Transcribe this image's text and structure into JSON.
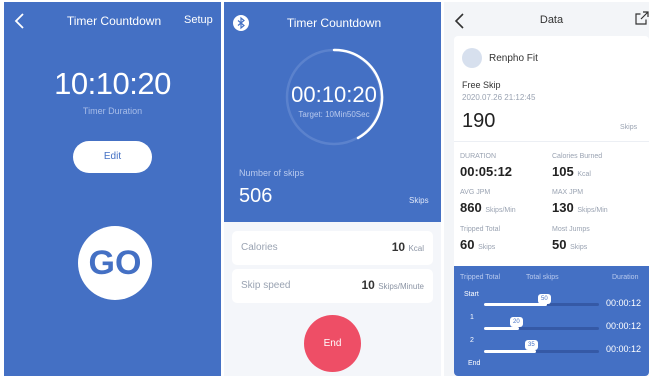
{
  "timer_setup": {
    "title": "Timer Countdown",
    "setup_label": "Setup",
    "time": "10:10:20",
    "subtitle": "Timer Duration",
    "edit_label": "Edit",
    "go_label": "GO",
    "background": "#4470c4"
  },
  "timer_running": {
    "title": "Timer Countdown",
    "time": "00:10:20",
    "target_text": "Target: 10Min50Sec",
    "skips_label": "Number of skips",
    "skips_value": "506",
    "skips_unit": "Skips",
    "calories_label": "Calories",
    "calories_value": "10",
    "calories_unit": "Kcal",
    "speed_label": "Skip speed",
    "speed_value": "10",
    "speed_unit": "Skips/Minute",
    "end_label": "End",
    "end_color": "#ee4e66"
  },
  "data_view": {
    "title": "Data",
    "brand": "Renpho Fit",
    "mode": "Free Skip",
    "datetime": "2020.07.26 21:12:45",
    "skips": "190",
    "skips_unit": "Skips",
    "metrics": [
      {
        "label": "DURATION",
        "value": "00:05:12",
        "unit": ""
      },
      {
        "label": "Calories Burned",
        "value": "105",
        "unit": "Kcal"
      },
      {
        "label": "AVG JPM",
        "value": "860",
        "unit": "Skips/Min"
      },
      {
        "label": "MAX JPM",
        "value": "130",
        "unit": "Skips/Min"
      },
      {
        "label": "Tripped Total",
        "value": "60",
        "unit": "Skips"
      },
      {
        "label": "Most Jumps",
        "value": "50",
        "unit": "Skips"
      }
    ],
    "table_headers": [
      "Tripped Total",
      "Total skips",
      "Duration"
    ],
    "rows": [
      {
        "label": "Start",
        "skips": "50",
        "duration": "00:00:12",
        "fraction": 0.55
      },
      {
        "label": "1",
        "skips": "20",
        "duration": "00:00:12",
        "fraction": 0.3
      },
      {
        "label": "2",
        "skips": "35",
        "duration": "00:00:12",
        "fraction": 0.45
      }
    ],
    "end_label": "End"
  }
}
